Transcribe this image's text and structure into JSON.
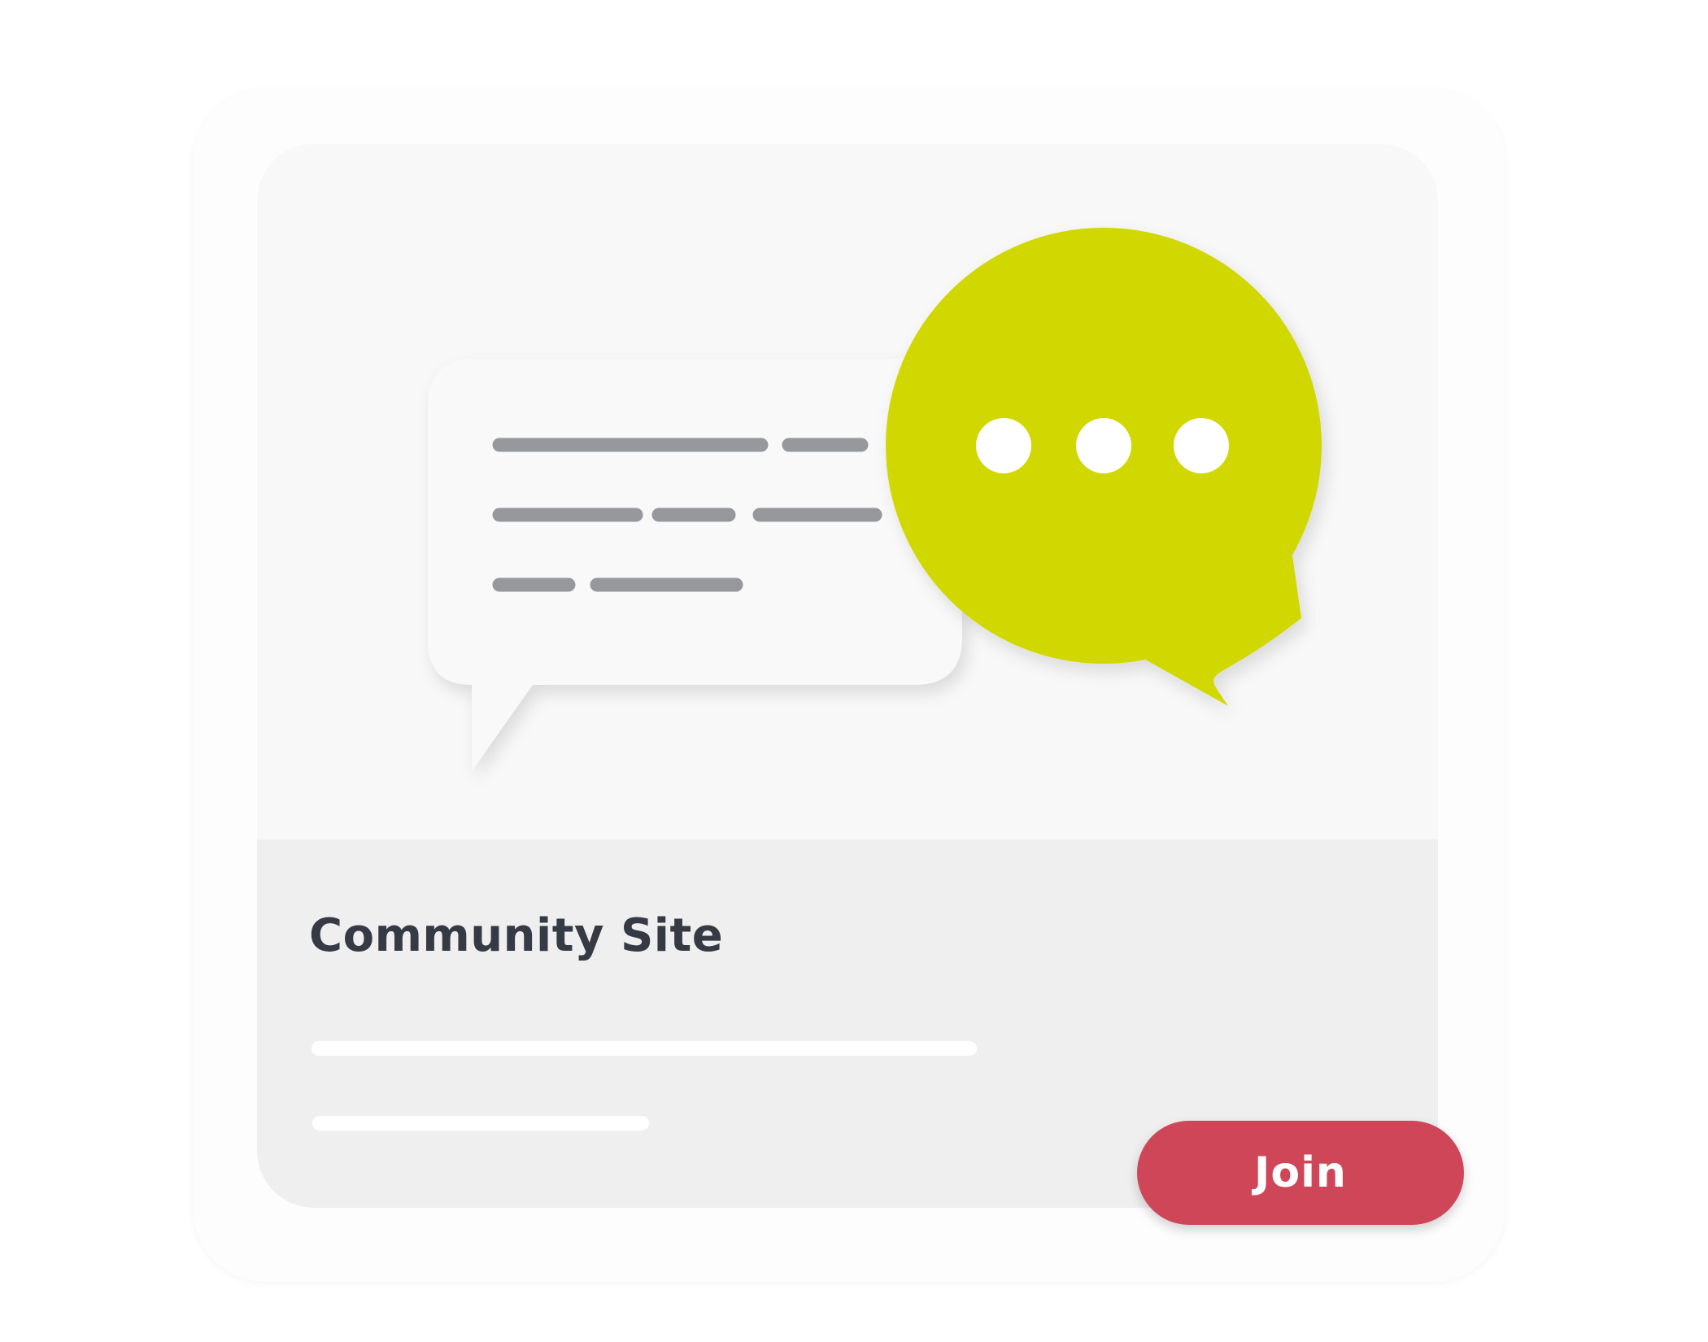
{
  "card": {
    "title": "Community Site",
    "join_label": "Join"
  },
  "colors": {
    "accent_bubble": "#d1d700",
    "join_button": "#cf4659",
    "title_text": "#363a45",
    "placeholder_line": "#96989c"
  },
  "icons": {
    "text_bubble": "speech-bubble-icon",
    "typing_bubble": "typing-bubble-icon"
  }
}
